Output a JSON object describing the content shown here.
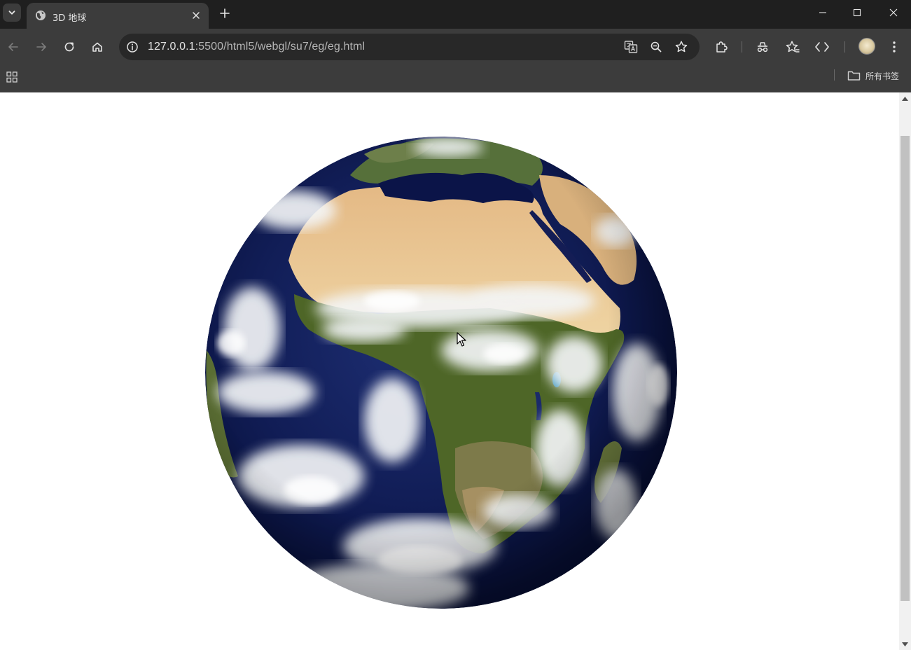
{
  "tab": {
    "title": "3D 地球",
    "icons": {
      "favicon": "globe-icon",
      "close": "close-icon",
      "list": "chevron-down-icon",
      "new": "plus-icon"
    }
  },
  "window_controls": {
    "minimize": "minimize-icon",
    "maximize": "maximize-icon",
    "close": "close-icon"
  },
  "toolbar": {
    "url_host": "127.0.0.1",
    "url_path": ":5500/html5/webgl/su7/eg/eg.html",
    "icons": [
      "back-arrow-icon",
      "forward-arrow-icon",
      "reload-icon",
      "home-icon",
      "site-info-icon",
      "translate-icon",
      "zoom-icon",
      "bookmark-star-icon",
      "extensions-icon",
      "performance-icon",
      "favorites-icon",
      "devtools-icon",
      "profile-avatar",
      "more-menu-icon"
    ]
  },
  "bookmarks_bar": {
    "apps_icon": "apps-grid-icon",
    "all_bookmarks_label": "所有书签",
    "folder_icon": "folder-icon"
  },
  "page": {
    "content": "3D earth globe rendered with WebGL, showing Africa, Europe and the Atlantic Ocean under cloud cover",
    "background": "#ffffff"
  },
  "colors": {
    "titlebar": "#1f1f1f",
    "toolbar": "#3c3c3c",
    "omnibox": "#282828",
    "ocean": "#0d1a4a",
    "desert": "#e9c99a",
    "vegetation": "#4f6b2a",
    "clouds": "#f3f5f7"
  }
}
